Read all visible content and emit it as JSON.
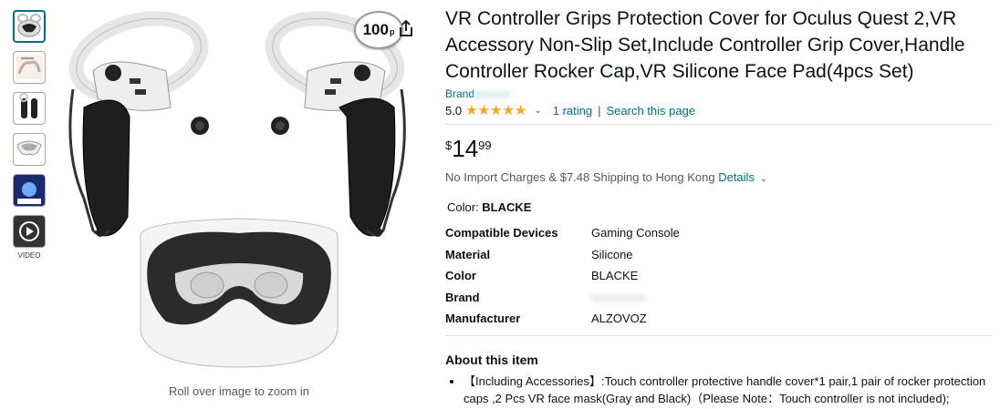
{
  "product": {
    "title": "VR Controller Grips Protection Cover for Oculus Quest 2,VR Accessory Non-Slip Set,Include Controller Grip Cover,Handle Controller Rocker Cap,VR Silicone Face Pad(4pcs Set)",
    "brand_label": "Brand",
    "rating_value": "5.0",
    "stars": 5,
    "rating_count": "1 rating",
    "search_page": "Search this page",
    "price_symbol": "$",
    "price_whole": "14",
    "price_fraction": "99",
    "shipping_text": "No Import Charges & $7.48 Shipping to Hong Kong",
    "details_link": "Details",
    "color_label": "Color: ",
    "color_value": "BLACKE",
    "zoom_note": "Roll over image to zoom in",
    "badge_text": "100",
    "badge_suffix": "p",
    "video_label": "VIDEO"
  },
  "specs": [
    {
      "key": "Compatible Devices",
      "value": "Gaming Console"
    },
    {
      "key": "Material",
      "value": "Silicone"
    },
    {
      "key": "Color",
      "value": "BLACKE"
    },
    {
      "key": "Brand",
      "value": ""
    },
    {
      "key": "Manufacturer",
      "value": "ALZOVOZ"
    }
  ],
  "about": {
    "title": "About this item",
    "bullets": [
      "【Including Accessories】:Touch controller protective handle cover*1 pair,1 pair of rocker protection caps ,2 Pcs VR face mask(Gray and Black)（Please Note：Touch controller is not included);"
    ]
  },
  "colors": {
    "link": "#007185",
    "star": "#ffa41c",
    "selected_thumb": "#007185"
  }
}
